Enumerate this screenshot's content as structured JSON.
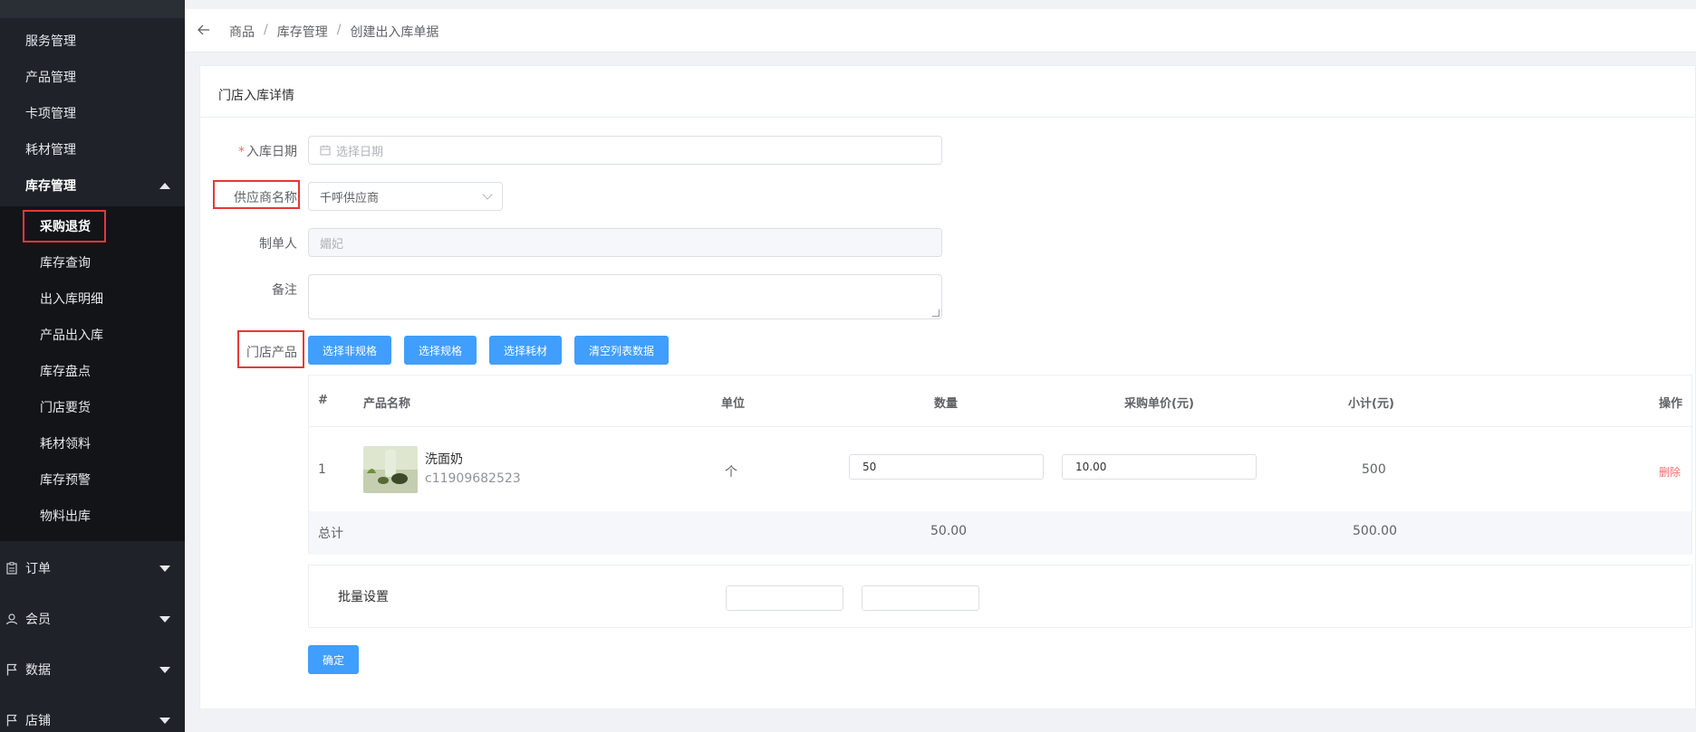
{
  "sidebar": {
    "items": [
      {
        "label": "服务管理"
      },
      {
        "label": "产品管理"
      },
      {
        "label": "卡项管理"
      },
      {
        "label": "耗材管理"
      },
      {
        "label": "库存管理"
      }
    ],
    "sub_items": [
      {
        "label": "采购退货"
      },
      {
        "label": "库存查询"
      },
      {
        "label": "出入库明细"
      },
      {
        "label": "产品出入库"
      },
      {
        "label": "库存盘点"
      },
      {
        "label": "门店要货"
      },
      {
        "label": "耗材领料"
      },
      {
        "label": "库存预警"
      },
      {
        "label": "物料出库"
      }
    ],
    "groups": [
      {
        "label": "订单",
        "icon": "clipboard-icon"
      },
      {
        "label": "会员",
        "icon": "user-icon"
      },
      {
        "label": "数据",
        "icon": "flag-icon"
      },
      {
        "label": "店铺",
        "icon": "flag-icon"
      }
    ]
  },
  "breadcrumb": {
    "items": [
      "商品",
      "库存管理",
      "创建出入库单据"
    ],
    "separator": "/"
  },
  "card": {
    "title": "门店入库详情"
  },
  "form": {
    "date_label": "入库日期",
    "date_placeholder": "选择日期",
    "supplier_label": "供应商名称",
    "supplier_value": "千呼供应商",
    "creator_label": "制单人",
    "creator_value": "媚妃",
    "remark_label": "备注",
    "products_label": "门店产品",
    "required_mark": "*"
  },
  "buttons": {
    "select_nonspec": "选择非规格",
    "select_spec": "选择规格",
    "select_consumable": "选择耗材",
    "clear_list": "清空列表数据",
    "confirm": "确定"
  },
  "table": {
    "headers": {
      "index": "#",
      "name": "产品名称",
      "unit": "单位",
      "quantity": "数量",
      "price": "采购单价(元)",
      "subtotal": "小计(元)",
      "action": "操作"
    },
    "rows": [
      {
        "index": "1",
        "name": "洗面奶",
        "code": "c11909682523",
        "unit": "个",
        "quantity": "50",
        "price": "10.00",
        "subtotal": "500",
        "action": "删除"
      }
    ],
    "total": {
      "label": "总计",
      "quantity": "50.00",
      "subtotal": "500.00"
    }
  },
  "batch": {
    "label": "批量设置"
  },
  "colors": {
    "primary": "#409eff",
    "danger": "#f56c6c",
    "sidebar_bg": "#1f2329",
    "highlight": "#e53935"
  }
}
